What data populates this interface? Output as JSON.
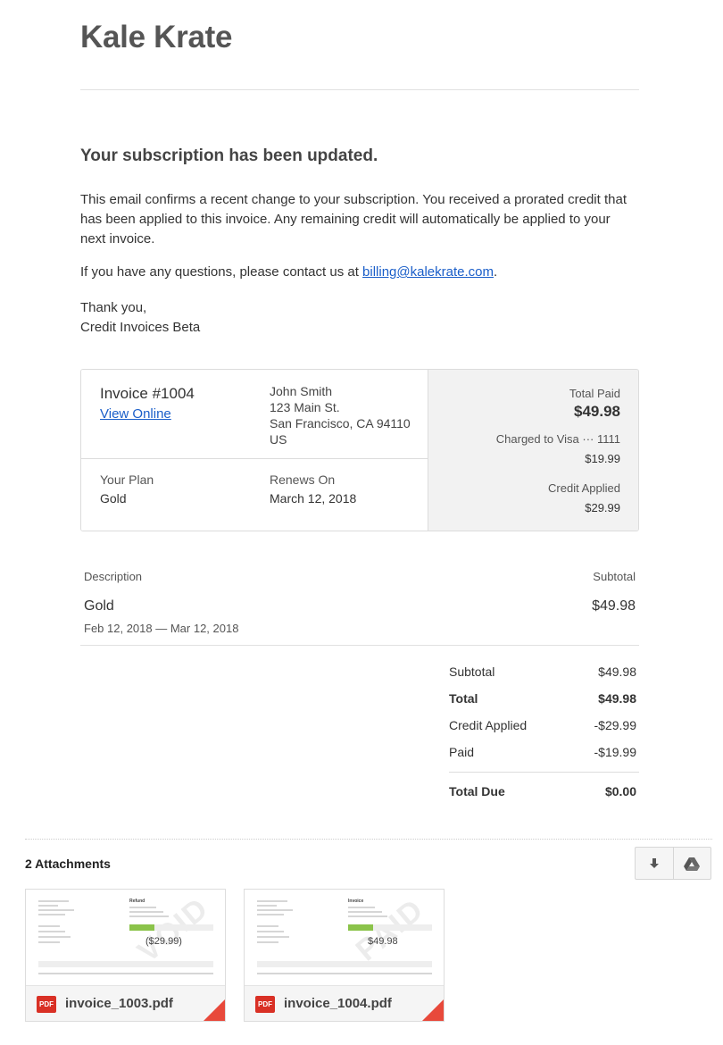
{
  "brand": "Kale Krate",
  "email": {
    "headline": "Your subscription has been updated.",
    "paragraph1": "This email confirms a recent change to your subscription. You received a prorated credit that has been applied to this invoice. Any remaining credit will automatically be applied to your next invoice.",
    "paragraph2_prefix": "If you have any questions, please contact us at ",
    "contact_email": "billing@kalekrate.com",
    "paragraph2_suffix": ".",
    "signoff": "Thank you,",
    "signature": "Credit Invoices Beta"
  },
  "invoice": {
    "number": "Invoice #1004",
    "view_online": "View Online",
    "address": [
      "John Smith",
      "123 Main St.",
      "San Francisco, CA 94110",
      "US"
    ],
    "plan_label": "Your Plan",
    "plan_value": "Gold",
    "renews_label": "Renews On",
    "renews_value": "March 12, 2018",
    "total_paid_label": "Total Paid",
    "total_paid_value": "$49.98",
    "charged_label": "Charged to Visa ··· 1111",
    "charged_value": "$19.99",
    "credit_label": "Credit Applied",
    "credit_value": "$29.99"
  },
  "line_items": {
    "header_description": "Description",
    "header_subtotal": "Subtotal",
    "item_name": "Gold",
    "item_amount": "$49.98",
    "item_dates": "Feb 12, 2018 — Mar 12, 2018"
  },
  "totals": [
    {
      "label": "Subtotal",
      "value": "$49.98"
    },
    {
      "label": "Total",
      "value": "$49.98"
    },
    {
      "label": "Credit Applied",
      "value": "-$29.99"
    },
    {
      "label": "Paid",
      "value": "-$19.99"
    },
    {
      "label": "Total Due",
      "value": "$0.00"
    }
  ],
  "attachments": {
    "title": "2 Attachments",
    "files": [
      {
        "name": "invoice_1003.pdf",
        "badge": "PDF",
        "thumb_amount": "($29.99)",
        "thumb_heading": "Refund"
      },
      {
        "name": "invoice_1004.pdf",
        "badge": "PDF",
        "thumb_amount": "$49.98",
        "thumb_heading": "Invoice"
      }
    ],
    "download_icon": "download-icon",
    "drive_icon": "google-drive-icon"
  }
}
